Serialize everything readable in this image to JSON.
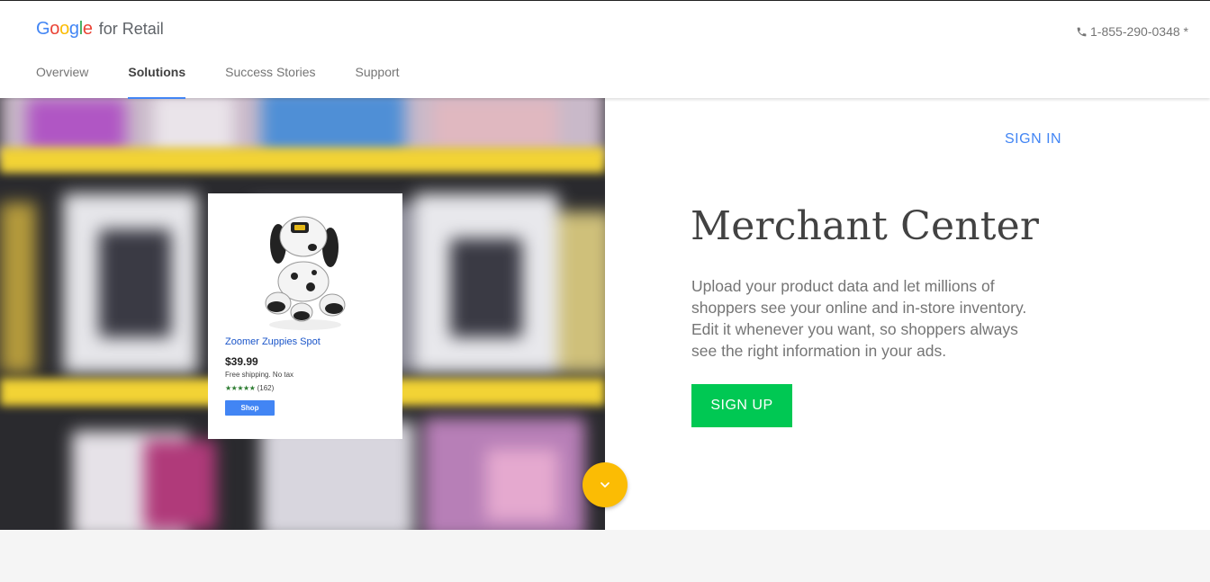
{
  "header": {
    "logo_google": "Google",
    "logo_suffix": "for Retail",
    "phone": "1-855-290-0348 *",
    "nav": [
      {
        "label": "Overview",
        "active": false
      },
      {
        "label": "Solutions",
        "active": true
      },
      {
        "label": "Success Stories",
        "active": false
      },
      {
        "label": "Support",
        "active": false
      }
    ]
  },
  "product_card": {
    "title": "Zoomer Zuppies Spot",
    "price": "$39.99",
    "shipping": "Free shipping. No tax",
    "stars": "★★★★★",
    "review_count": "(162)",
    "button": "Shop"
  },
  "main": {
    "sign_in": "SIGN IN",
    "title": "Merchant Center",
    "description": "Upload your product data and let millions of shoppers see your online and in-store inventory. Edit it whenever you want, so shoppers always see the right information in your ads.",
    "sign_up": "SIGN UP"
  },
  "icons": {
    "phone": "phone-icon",
    "scroll": "chevron-down-icon"
  },
  "colors": {
    "accent_blue": "#4285f4",
    "signup_green": "#00c853",
    "scroll_yellow": "#fbbc04"
  }
}
